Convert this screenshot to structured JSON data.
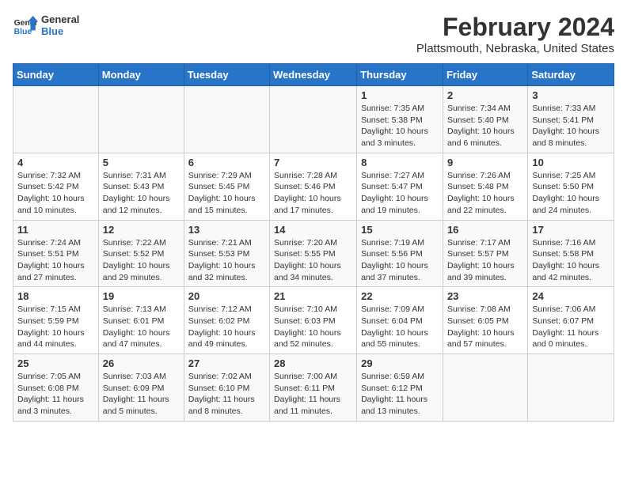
{
  "logo": {
    "line1": "General",
    "line2": "Blue"
  },
  "title": "February 2024",
  "location": "Plattsmouth, Nebraska, United States",
  "days_of_week": [
    "Sunday",
    "Monday",
    "Tuesday",
    "Wednesday",
    "Thursday",
    "Friday",
    "Saturday"
  ],
  "weeks": [
    [
      {
        "day": "",
        "info": ""
      },
      {
        "day": "",
        "info": ""
      },
      {
        "day": "",
        "info": ""
      },
      {
        "day": "",
        "info": ""
      },
      {
        "day": "1",
        "info": "Sunrise: 7:35 AM\nSunset: 5:38 PM\nDaylight: 10 hours and 3 minutes."
      },
      {
        "day": "2",
        "info": "Sunrise: 7:34 AM\nSunset: 5:40 PM\nDaylight: 10 hours and 6 minutes."
      },
      {
        "day": "3",
        "info": "Sunrise: 7:33 AM\nSunset: 5:41 PM\nDaylight: 10 hours and 8 minutes."
      }
    ],
    [
      {
        "day": "4",
        "info": "Sunrise: 7:32 AM\nSunset: 5:42 PM\nDaylight: 10 hours and 10 minutes."
      },
      {
        "day": "5",
        "info": "Sunrise: 7:31 AM\nSunset: 5:43 PM\nDaylight: 10 hours and 12 minutes."
      },
      {
        "day": "6",
        "info": "Sunrise: 7:29 AM\nSunset: 5:45 PM\nDaylight: 10 hours and 15 minutes."
      },
      {
        "day": "7",
        "info": "Sunrise: 7:28 AM\nSunset: 5:46 PM\nDaylight: 10 hours and 17 minutes."
      },
      {
        "day": "8",
        "info": "Sunrise: 7:27 AM\nSunset: 5:47 PM\nDaylight: 10 hours and 19 minutes."
      },
      {
        "day": "9",
        "info": "Sunrise: 7:26 AM\nSunset: 5:48 PM\nDaylight: 10 hours and 22 minutes."
      },
      {
        "day": "10",
        "info": "Sunrise: 7:25 AM\nSunset: 5:50 PM\nDaylight: 10 hours and 24 minutes."
      }
    ],
    [
      {
        "day": "11",
        "info": "Sunrise: 7:24 AM\nSunset: 5:51 PM\nDaylight: 10 hours and 27 minutes."
      },
      {
        "day": "12",
        "info": "Sunrise: 7:22 AM\nSunset: 5:52 PM\nDaylight: 10 hours and 29 minutes."
      },
      {
        "day": "13",
        "info": "Sunrise: 7:21 AM\nSunset: 5:53 PM\nDaylight: 10 hours and 32 minutes."
      },
      {
        "day": "14",
        "info": "Sunrise: 7:20 AM\nSunset: 5:55 PM\nDaylight: 10 hours and 34 minutes."
      },
      {
        "day": "15",
        "info": "Sunrise: 7:19 AM\nSunset: 5:56 PM\nDaylight: 10 hours and 37 minutes."
      },
      {
        "day": "16",
        "info": "Sunrise: 7:17 AM\nSunset: 5:57 PM\nDaylight: 10 hours and 39 minutes."
      },
      {
        "day": "17",
        "info": "Sunrise: 7:16 AM\nSunset: 5:58 PM\nDaylight: 10 hours and 42 minutes."
      }
    ],
    [
      {
        "day": "18",
        "info": "Sunrise: 7:15 AM\nSunset: 5:59 PM\nDaylight: 10 hours and 44 minutes."
      },
      {
        "day": "19",
        "info": "Sunrise: 7:13 AM\nSunset: 6:01 PM\nDaylight: 10 hours and 47 minutes."
      },
      {
        "day": "20",
        "info": "Sunrise: 7:12 AM\nSunset: 6:02 PM\nDaylight: 10 hours and 49 minutes."
      },
      {
        "day": "21",
        "info": "Sunrise: 7:10 AM\nSunset: 6:03 PM\nDaylight: 10 hours and 52 minutes."
      },
      {
        "day": "22",
        "info": "Sunrise: 7:09 AM\nSunset: 6:04 PM\nDaylight: 10 hours and 55 minutes."
      },
      {
        "day": "23",
        "info": "Sunrise: 7:08 AM\nSunset: 6:05 PM\nDaylight: 10 hours and 57 minutes."
      },
      {
        "day": "24",
        "info": "Sunrise: 7:06 AM\nSunset: 6:07 PM\nDaylight: 11 hours and 0 minutes."
      }
    ],
    [
      {
        "day": "25",
        "info": "Sunrise: 7:05 AM\nSunset: 6:08 PM\nDaylight: 11 hours and 3 minutes."
      },
      {
        "day": "26",
        "info": "Sunrise: 7:03 AM\nSunset: 6:09 PM\nDaylight: 11 hours and 5 minutes."
      },
      {
        "day": "27",
        "info": "Sunrise: 7:02 AM\nSunset: 6:10 PM\nDaylight: 11 hours and 8 minutes."
      },
      {
        "day": "28",
        "info": "Sunrise: 7:00 AM\nSunset: 6:11 PM\nDaylight: 11 hours and 11 minutes."
      },
      {
        "day": "29",
        "info": "Sunrise: 6:59 AM\nSunset: 6:12 PM\nDaylight: 11 hours and 13 minutes."
      },
      {
        "day": "",
        "info": ""
      },
      {
        "day": "",
        "info": ""
      }
    ]
  ]
}
